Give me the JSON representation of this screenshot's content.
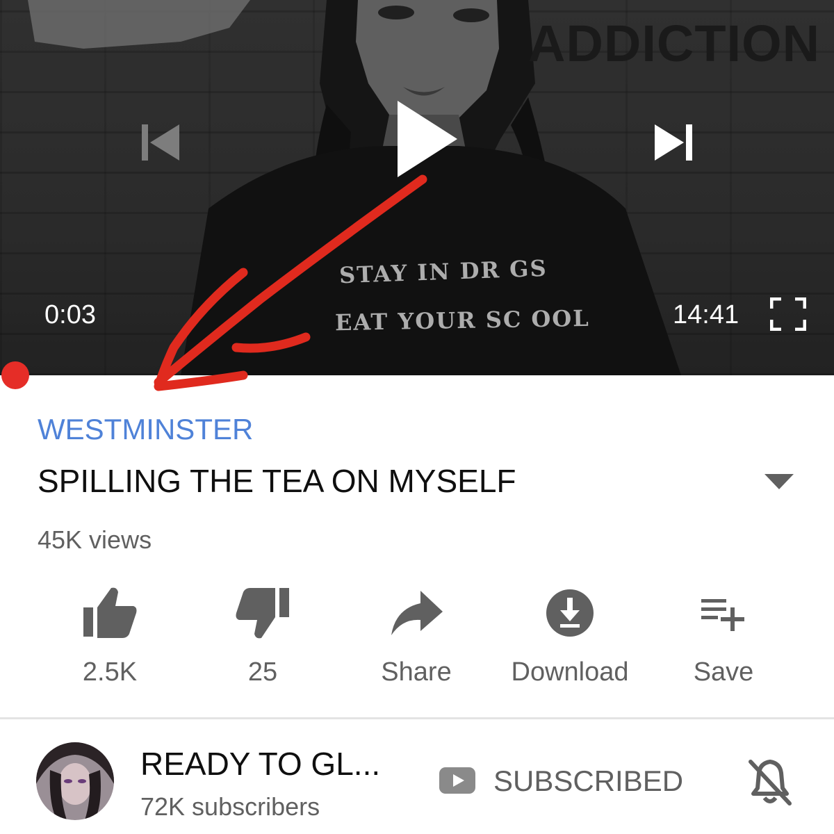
{
  "player": {
    "thumbnail_text": "ADDICTION",
    "shirt_line_1": "STAY IN DR GS",
    "shirt_line_2": "EAT YOUR SC OOL",
    "current_time": "0:03",
    "total_time": "14:41",
    "progress_fraction": 0.002,
    "icons": {
      "previous": "skip-previous-icon",
      "play": "play-icon",
      "next": "skip-next-icon",
      "fullscreen": "fullscreen-icon"
    }
  },
  "video": {
    "hashtag": "WESTMINSTER",
    "title": "SPILLING THE TEA ON MYSELF",
    "views": "45K views"
  },
  "actions": {
    "like": {
      "label": "2.5K",
      "icon": "thumbs-up-icon"
    },
    "dislike": {
      "label": "25",
      "icon": "thumbs-down-icon"
    },
    "share": {
      "label": "Share",
      "icon": "share-arrow-icon"
    },
    "download": {
      "label": "Download",
      "icon": "download-icon"
    },
    "save": {
      "label": "Save",
      "icon": "playlist-add-icon"
    }
  },
  "channel": {
    "name": "READY TO GL...",
    "subscribers": "72K subscribers",
    "subscribe_label": "SUBSCRIBED",
    "notification_icon": "bell-off-icon"
  },
  "colors": {
    "progress_red": "#e52d27",
    "hashtag_blue": "#4f82d8",
    "annotation_red": "#e02a1e",
    "secondary_text": "#606060"
  }
}
